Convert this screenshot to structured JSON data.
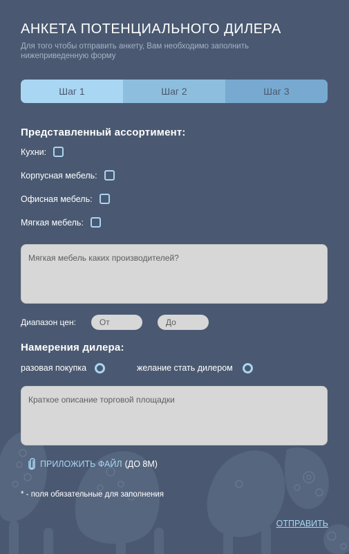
{
  "header": {
    "title": "АНКЕТА ПОТЕНЦИАЛЬНОГО ДИЛЕРА",
    "subtitle": "Для того чтобы отправить анкету, Вам необходимо заполнить нижеприведенную форму"
  },
  "steps": [
    {
      "label": "Шаг 1",
      "active": true
    },
    {
      "label": "Шаг 2",
      "active": false
    },
    {
      "label": "Шаг 3",
      "active": false
    }
  ],
  "assortment": {
    "title": "Представленный ассортимент:",
    "items": [
      {
        "label": "Кухни:",
        "checked": false
      },
      {
        "label": "Корпусная мебель:",
        "checked": false
      },
      {
        "label": "Офисная мебель:",
        "checked": false
      },
      {
        "label": "Мягкая мебель:",
        "checked": false
      }
    ],
    "manufacturers_placeholder": "Мягкая мебель каких производителей?"
  },
  "price": {
    "label": "Диапазон цен:",
    "from_placeholder": "От",
    "to_placeholder": "До"
  },
  "intentions": {
    "title": "Намерения дилера:",
    "option_one": "разовая покупка",
    "option_two": "желание стать дилером",
    "description_placeholder": "Краткое описание торговой площадки"
  },
  "attach": {
    "link_label": "ПРИЛОЖИТЬ ФАЙЛ",
    "limit": "(ДО 8М)"
  },
  "required_note": "* - поля обязательные для заполнения",
  "submit_label": "ОТПРАВИТЬ",
  "colors": {
    "background": "#4a5971",
    "accent": "#a9d6f3",
    "step_active": "#a9d6f3",
    "step_mid": "#8dbede",
    "step_dark": "#78aad1",
    "field": "#d7d7d7"
  }
}
